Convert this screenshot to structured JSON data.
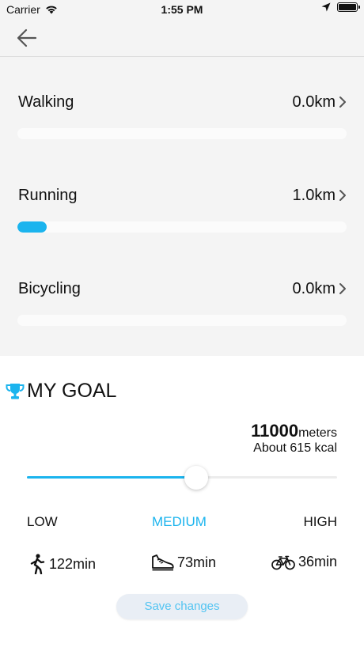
{
  "status_bar": {
    "carrier": "Carrier",
    "time": "1:55 PM"
  },
  "nav": {
    "back_icon": "arrow-left-icon"
  },
  "activities": [
    {
      "label": "Walking",
      "value": "0.0km",
      "progress": 0.0
    },
    {
      "label": "Running",
      "value": "1.0km",
      "progress": 0.09
    },
    {
      "label": "Bicycling",
      "value": "0.0km",
      "progress": 0.0
    }
  ],
  "goal": {
    "title": "MY GOAL",
    "meters_value": "11000",
    "meters_unit": "meters",
    "kcal_text": "About 615 kcal",
    "slider_value": 0.545,
    "levels": {
      "low": "LOW",
      "medium": "MEDIUM",
      "high": "HIGH"
    },
    "selected_level": "MEDIUM",
    "durations": {
      "walking": "122min",
      "running": "73min",
      "bicycling": "36min"
    },
    "save_label": "Save changes"
  },
  "colors": {
    "accent": "#1bb4ee",
    "background_gray": "#f4f4f4",
    "trophy": "#1bb4ee"
  }
}
